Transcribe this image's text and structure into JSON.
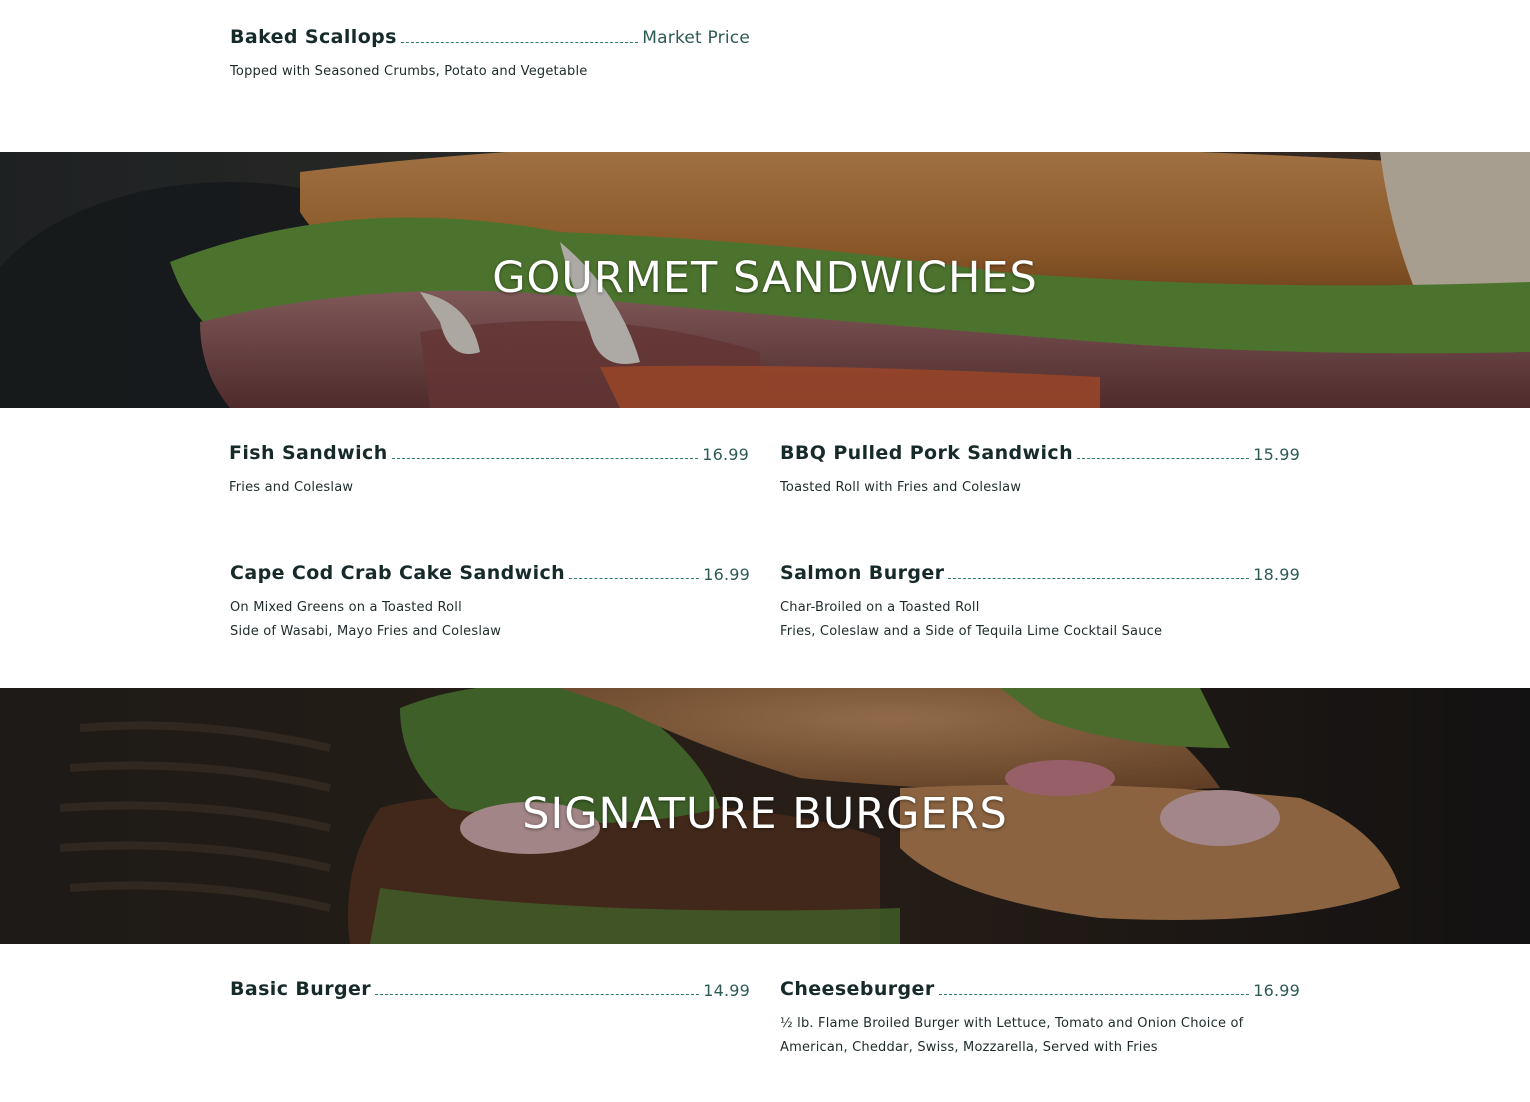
{
  "colors": {
    "title_text": "#172a2a",
    "price_text": "#2d5a55",
    "leader": "#2f7a72",
    "banner_title": "#ffffff"
  },
  "seafood": {
    "items": [
      {
        "name": "Baked Scallops",
        "price": "Market Price",
        "desc": [
          "Topped with Seasoned Crumbs, Potato and Vegetable"
        ]
      }
    ]
  },
  "sandwiches": {
    "banner_title": "GOURMET SANDWICHES",
    "banner_image": "sandwich-photo",
    "items": [
      {
        "name": "Fish Sandwich",
        "price": "16.99",
        "desc": [
          "Fries and Coleslaw"
        ]
      },
      {
        "name": "BBQ Pulled Pork Sandwich",
        "price": "15.99",
        "desc": [
          "Toasted Roll with Fries and Coleslaw"
        ]
      },
      {
        "name": "Cape Cod Crab Cake Sandwich",
        "price": "16.99",
        "desc": [
          "On Mixed Greens on a Toasted Roll",
          "Side of Wasabi, Mayo Fries and Coleslaw"
        ]
      },
      {
        "name": "Salmon Burger",
        "price": "18.99",
        "desc": [
          "Char-Broiled on a Toasted Roll",
          "Fries, Coleslaw and a Side of Tequila Lime Cocktail Sauce"
        ]
      }
    ]
  },
  "burgers": {
    "banner_title": "SIGNATURE BURGERS",
    "banner_image": "burger-photo",
    "items": [
      {
        "name": "Basic Burger",
        "price": "14.99",
        "desc": []
      },
      {
        "name": "Cheeseburger",
        "price": "16.99",
        "desc": [
          "½ lb. Flame Broiled Burger with Lettuce, Tomato and Onion Choice of",
          "American, Cheddar, Swiss, Mozzarella, Served with Fries"
        ]
      }
    ]
  }
}
